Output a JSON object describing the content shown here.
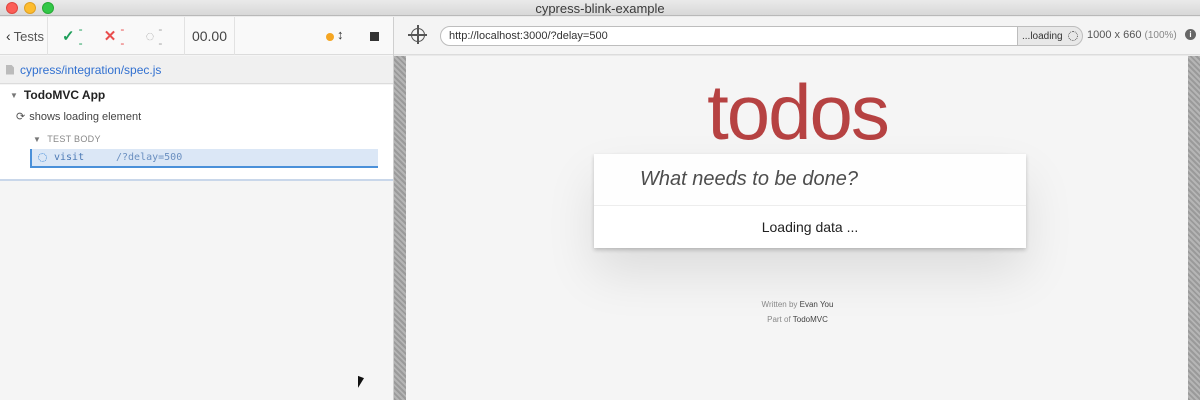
{
  "window": {
    "title": "cypress-blink-example"
  },
  "reporter": {
    "tests_label": "Tests",
    "stats": {
      "passed": "--",
      "failed": "--",
      "pending": "--"
    },
    "duration": "00.00",
    "spec_path": "cypress/integration/spec.js",
    "suite_title": "TodoMVC App",
    "test_title": "shows loading element",
    "body_header": "TEST BODY",
    "command": {
      "name": "visit",
      "message": "/?delay=500"
    }
  },
  "aut": {
    "url": "http://localhost:3000/?delay=500",
    "loading_label": "...loading",
    "viewport": "1000 x 660",
    "viewport_pct": "(100%)",
    "app": {
      "title": "todos",
      "new_todo_placeholder": "What needs to be done?",
      "loading_text": "Loading data ...",
      "written_by_prefix": "Written by",
      "author": "Evan You",
      "part_of_prefix": "Part of",
      "project": "TodoMVC"
    }
  },
  "colors": {
    "accent": "#3170d0",
    "passed": "#1e9e5a",
    "failed": "#e94e4e",
    "todos_title": "#af2f2f",
    "running": "#f5a623"
  }
}
